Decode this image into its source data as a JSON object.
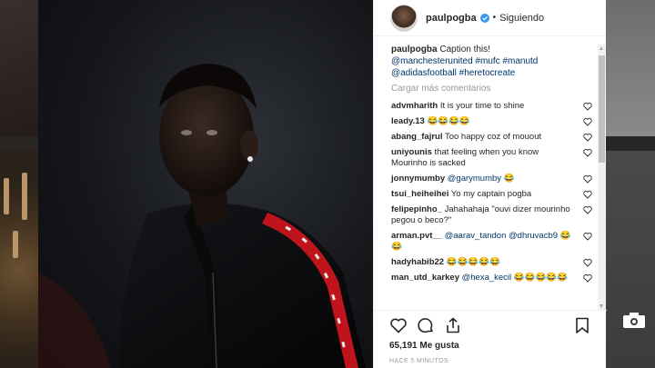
{
  "post": {
    "header": {
      "username": "paulpogba",
      "separator": "•",
      "follow_label": "Siguiendo"
    },
    "caption": {
      "username": "paulpogba",
      "text": "Caption this!",
      "tags_line1": "@manchesterunited #mufc #manutd",
      "tags_line2": "@adidasfootball #heretocreate"
    },
    "load_more": "Cargar más comentarios",
    "comments": [
      {
        "user": "advmharith",
        "text": "It is your time to shine"
      },
      {
        "user": "leady.13",
        "text": "😂😂😂😂"
      },
      {
        "user": "abang_fajrul",
        "text": "Too happy coz of mouout"
      },
      {
        "user": "uniyounis",
        "text": "that feeling when you know Mourinho is sacked"
      },
      {
        "user": "jonnymumby",
        "mention": "@garymumby",
        "text": "😂"
      },
      {
        "user": "tsui_heiheihei",
        "text": "Yo my captain pogba"
      },
      {
        "user": "felipepinho_",
        "text": "Jahahahaja \"ouvi dizer mourinho pegou o beco?\""
      },
      {
        "user": "arman.pvt__",
        "mention": "@aarav_tandon",
        "mention2": "@dhruvacb9",
        "text": "😂😂"
      },
      {
        "user": "hadyhabib22",
        "text": "😂😂😂😂😂"
      },
      {
        "user": "man_utd_karkey",
        "mention": "@hexa_kecil",
        "text": "😂😂😂😂😂"
      }
    ],
    "likes": "65,191 Me gusta",
    "timestamp": "HACE 5 MINUTOS"
  },
  "icons": {
    "like": "heart-icon",
    "comment": "comment-icon",
    "share": "share-icon",
    "save": "bookmark-icon",
    "verified": "verified-badge-icon",
    "video": "video-camera-icon"
  },
  "colors": {
    "link": "#003569",
    "verified": "#3897f0",
    "muted": "#999999",
    "stripe_red": "#c0141c"
  }
}
